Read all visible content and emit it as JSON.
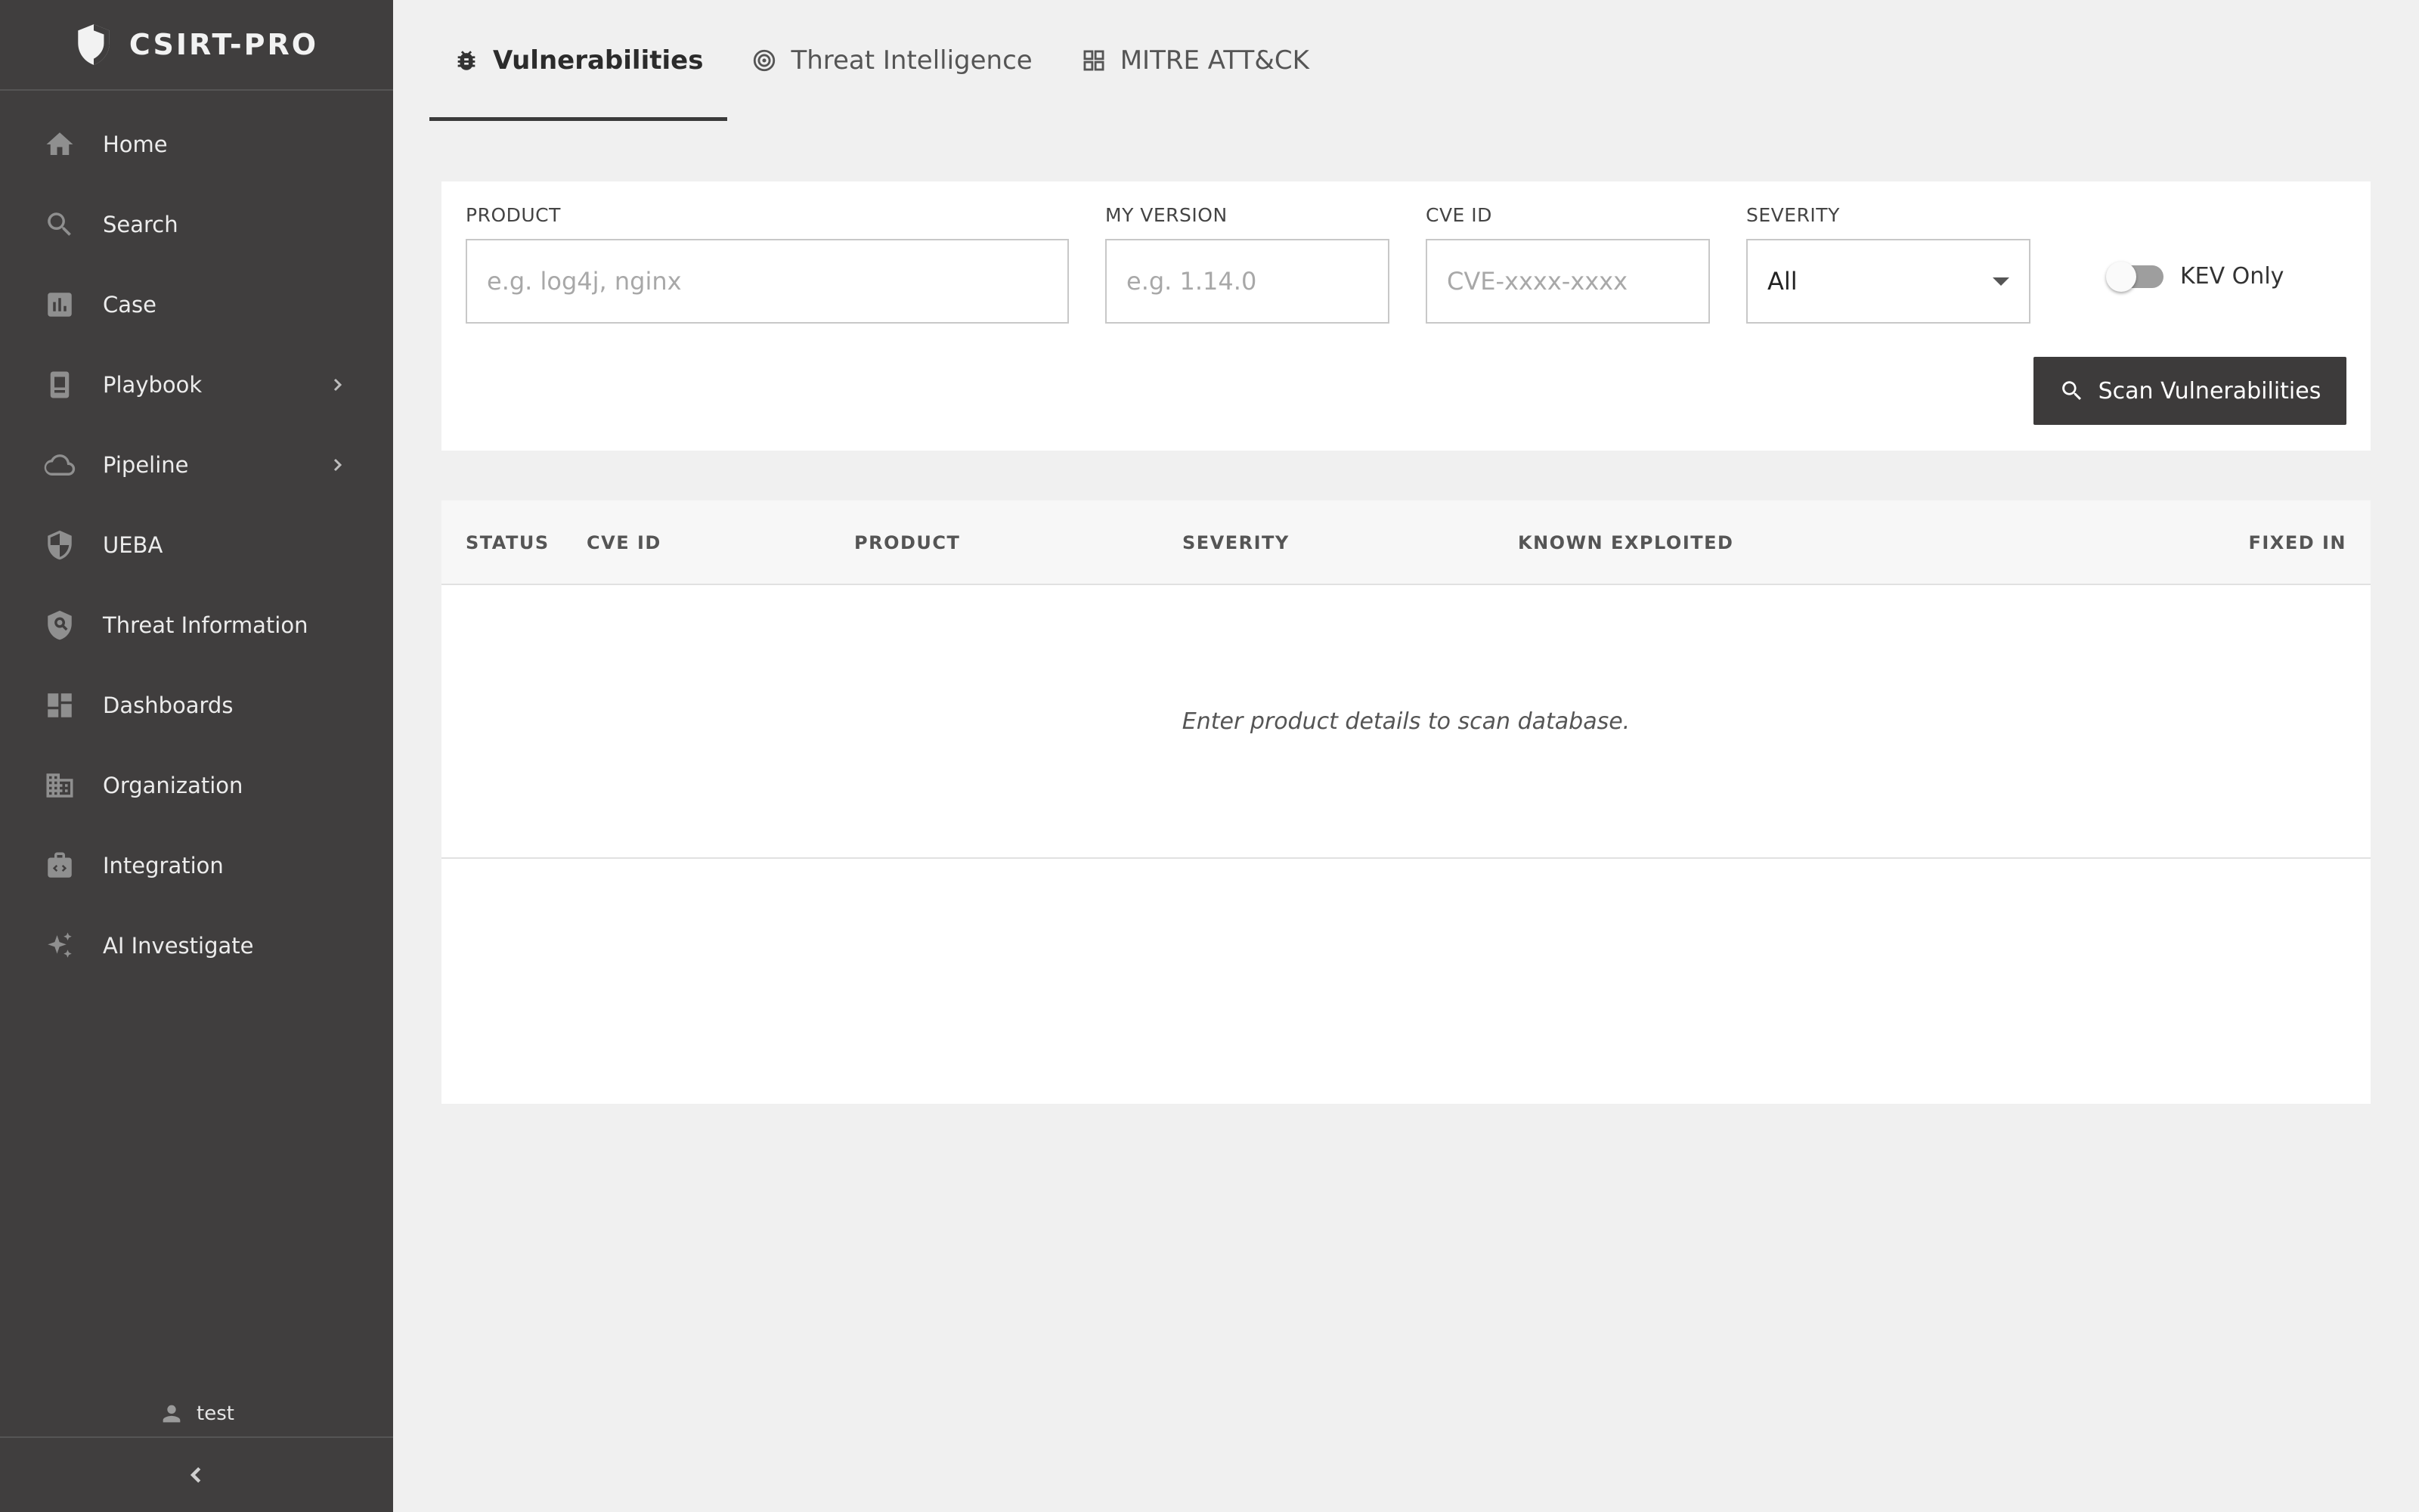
{
  "app": {
    "name": "CSIRT-PRO"
  },
  "sidebar": {
    "items": [
      {
        "label": "Home",
        "icon": "home-icon"
      },
      {
        "label": "Search",
        "icon": "search-icon"
      },
      {
        "label": "Case",
        "icon": "bar-chart-icon"
      },
      {
        "label": "Playbook",
        "icon": "book-icon",
        "expandable": true
      },
      {
        "label": "Pipeline",
        "icon": "cloud-icon",
        "expandable": true
      },
      {
        "label": "UEBA",
        "icon": "shield-icon"
      },
      {
        "label": "Threat Information",
        "icon": "shield-search-icon"
      },
      {
        "label": "Dashboards",
        "icon": "dashboard-icon"
      },
      {
        "label": "Organization",
        "icon": "building-icon"
      },
      {
        "label": "Integration",
        "icon": "integration-icon"
      },
      {
        "label": "AI Investigate",
        "icon": "sparkle-icon"
      }
    ],
    "user": "test"
  },
  "tabs": [
    {
      "label": "Vulnerabilities",
      "icon": "bug-icon",
      "active": true
    },
    {
      "label": "Threat Intelligence",
      "icon": "target-icon",
      "active": false
    },
    {
      "label": "MITRE ATT&CK",
      "icon": "grid-icon",
      "active": false
    }
  ],
  "filters": {
    "product": {
      "label": "PRODUCT",
      "placeholder": "e.g. log4j, nginx",
      "value": ""
    },
    "version": {
      "label": "MY VERSION",
      "placeholder": "e.g. 1.14.0",
      "value": ""
    },
    "cve": {
      "label": "CVE ID",
      "placeholder": "CVE-xxxx-xxxx",
      "value": ""
    },
    "severity": {
      "label": "SEVERITY",
      "value": "All"
    },
    "kev_only": {
      "label": "KEV Only",
      "checked": false
    },
    "scan_button": "Scan Vulnerabilities"
  },
  "table": {
    "columns": [
      "STATUS",
      "CVE ID",
      "PRODUCT",
      "SEVERITY",
      "KNOWN EXPLOITED",
      "FIXED IN"
    ],
    "empty_message": "Enter product details to scan database.",
    "rows": []
  },
  "colors": {
    "sidebar_bg": "#403e3e",
    "page_bg": "#f0f0f0",
    "primary_button": "#3d3b3b"
  }
}
